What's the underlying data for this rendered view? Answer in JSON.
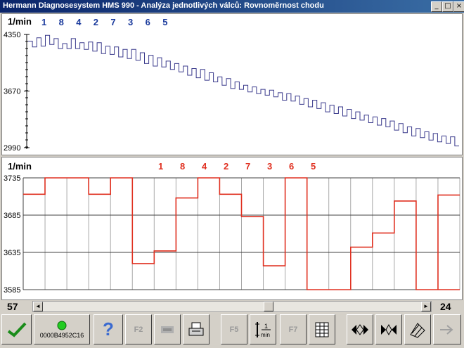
{
  "window": {
    "title": "Hermann Diagnosesystem HMS 990 - Analýza jednotlivých válců: Rovnoměrnost chodu",
    "controls": [
      "_",
      "□",
      "×"
    ]
  },
  "top_chart": {
    "unit": "1/min",
    "cylinder_order": [
      "1",
      "8",
      "4",
      "2",
      "7",
      "3",
      "6",
      "5"
    ],
    "y_ticks": [
      "4350",
      "3670",
      "2990"
    ],
    "ymin": 2990,
    "ymax": 4350,
    "line_color": "#3a3a8c"
  },
  "bottom_chart": {
    "unit": "1/min",
    "cylinder_order": [
      "1",
      "8",
      "4",
      "2",
      "7",
      "3",
      "6",
      "5"
    ],
    "y_ticks": [
      "3735",
      "3685",
      "3635",
      "3585"
    ],
    "ymin": 3585,
    "ymax": 3735,
    "line_color": "#e03020"
  },
  "chart_data": [
    {
      "type": "line",
      "ylabel": "1/min",
      "ylim": [
        2990,
        4350
      ],
      "series": [
        {
          "values": [
            4270,
            4200,
            4310,
            4210,
            4340,
            4230,
            4300,
            4180,
            4240,
            4180,
            4300,
            4180,
            4250,
            4170,
            4260,
            4150,
            4250,
            4120,
            4210,
            4110,
            4200,
            4080,
            4170,
            4060,
            4170,
            4040,
            4130,
            4000,
            4100,
            3970,
            4070,
            3960,
            4030,
            3930,
            4000,
            3900,
            3970,
            3860,
            3940,
            3830,
            3930,
            3800,
            3890,
            3780,
            3840,
            3740,
            3820,
            3700,
            3780,
            3690,
            3740,
            3660,
            3720,
            3640,
            3690,
            3620,
            3680,
            3600,
            3650,
            3560,
            3640,
            3550,
            3610,
            3510,
            3580,
            3480,
            3560,
            3460,
            3530,
            3420,
            3500,
            3400,
            3480,
            3370,
            3450,
            3340,
            3420,
            3320,
            3380,
            3290,
            3360,
            3260,
            3340,
            3240,
            3310,
            3200,
            3280,
            3170,
            3240,
            3130,
            3220,
            3110,
            3180,
            3080,
            3160,
            3060,
            3130,
            3040,
            3120,
            3010
          ]
        }
      ]
    },
    {
      "type": "line",
      "ylabel": "1/min",
      "ylim": [
        3585,
        3735
      ],
      "series": [
        {
          "x": [
            57,
            56,
            55,
            54,
            53,
            52,
            51,
            50,
            49,
            48,
            47,
            46,
            45,
            44,
            43,
            42,
            41,
            40,
            39,
            38,
            37,
            36,
            35,
            34,
            33,
            32,
            31,
            30,
            29,
            28,
            27,
            26,
            25,
            24
          ],
          "values": [
            3713,
            3735,
            3735,
            3713,
            3735,
            3620,
            3637,
            3708,
            3735,
            3713,
            3683,
            3617,
            3735,
            3585,
            3585,
            3642,
            3661,
            3704,
            3585,
            3585,
            3585,
            3596,
            3585,
            3712,
            null,
            null,
            null,
            null,
            null,
            null,
            null,
            null,
            null,
            null
          ]
        }
      ]
    }
  ],
  "scrollbar": {
    "left_value": "57",
    "right_value": "24",
    "left_arrow": "◄",
    "right_arrow": "►"
  },
  "toolbar": {
    "confirm_icon": "checkmark-icon",
    "status_id": "0000B4952C16",
    "status_color": "#22cc22",
    "help_label": "?",
    "f2_label": "F2",
    "f5_label": "F5",
    "rpm_label": "min",
    "f7_label": "F7"
  }
}
